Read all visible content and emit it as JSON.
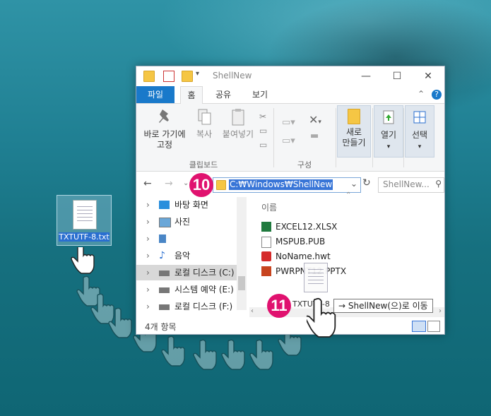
{
  "desktop": {
    "file_label": "TXTUTF-8.txt"
  },
  "window": {
    "title": "ShellNew",
    "controls": {
      "minimize": "—",
      "maximize": "☐",
      "close": "✕"
    }
  },
  "ribbon": {
    "tabs": [
      "파일",
      "홈",
      "공유",
      "보기"
    ],
    "buttons": {
      "pin": "바로 가기에\n고정",
      "copy": "복사",
      "paste": "붙여넣기",
      "new_folder": "새로\n만들기",
      "open": "열기",
      "select": "선택"
    },
    "groups": {
      "clipboard": "클립보드",
      "organize": "구성"
    }
  },
  "address": {
    "path": "C:₩Windows₩ShellNew",
    "search_placeholder": "ShellNew..."
  },
  "nav": {
    "items": [
      "바탕 화면",
      "사진",
      "",
      "음악",
      "로컬 디스크 (C:)",
      "시스템 예약 (E:)",
      "로컬 디스크 (F:)"
    ]
  },
  "list": {
    "column": "이름",
    "files": [
      "EXCEL12.XLSX",
      "MSPUB.PUB",
      "NoName.hwt",
      "PWRPNT12.PPTX"
    ]
  },
  "status": "4개 항목",
  "drag": {
    "ghost_label": "TXTUTF-8",
    "tooltip": "→ ShellNew(으)로 이동"
  },
  "steps": [
    "10",
    "11"
  ]
}
